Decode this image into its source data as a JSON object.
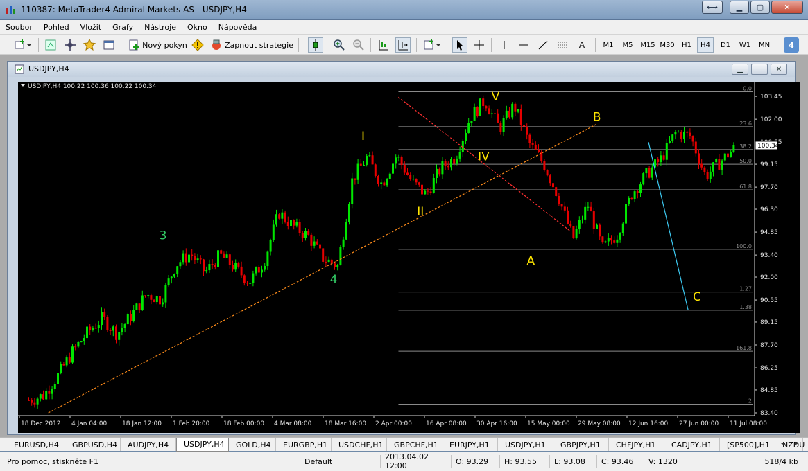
{
  "window": {
    "title": "110387: MetaTrader4 Admiral Markets AS - USDJPY,H4"
  },
  "menu": [
    "Soubor",
    "Pohled",
    "Vložit",
    "Grafy",
    "Nástroje",
    "Okno",
    "Nápověda"
  ],
  "toolbar": {
    "new_order": "Nový pokyn",
    "strategies": "Zapnout strategie",
    "timeframes": [
      "M1",
      "M5",
      "M15",
      "M30",
      "H1",
      "H4",
      "D1",
      "W1",
      "MN"
    ],
    "active_timeframe": "H4",
    "text_tool": "A",
    "badge": "4"
  },
  "chart_window": {
    "title": "USDJPY,H4",
    "info": "USDJPY,H4  100.22 100.36 100.22 100.34",
    "current_price": "100.34"
  },
  "chart_data": {
    "type": "candlestick",
    "symbol": "USDJPY",
    "timeframe": "H4",
    "ylim": [
      83.4,
      104.2
    ],
    "price_ticks": [
      103.45,
      102.0,
      100.55,
      99.15,
      97.7,
      96.3,
      94.85,
      93.4,
      92.0,
      90.55,
      89.15,
      87.7,
      86.25,
      84.85,
      83.4
    ],
    "price_tick_labels": [
      "103.45",
      "102.00",
      "100.55",
      "99.15",
      "97.70",
      "96.30",
      "94.85",
      "93.40",
      "92.00",
      "90.55",
      "89.15",
      "87.70",
      "86.25",
      "84.85",
      "83.40"
    ],
    "time_labels": [
      "18 Dec 2012",
      "4 Jan 04:00",
      "18 Jan 12:00",
      "1 Feb 20:00",
      "18 Feb 00:00",
      "4 Mar 08:00",
      "18 Mar 16:00",
      "2 Apr 00:00",
      "16 Apr 08:00",
      "30 Apr 16:00",
      "15 May 00:00",
      "29 May 08:00",
      "12 Jun 16:00",
      "27 Jun 00:00",
      "11 Jul 08:00"
    ],
    "price_path": [
      [
        0,
        84.2
      ],
      [
        1,
        84.5
      ],
      [
        2,
        85.8
      ],
      [
        3,
        87.3
      ],
      [
        4,
        88.5
      ],
      [
        5,
        89.4
      ],
      [
        6,
        88.4
      ],
      [
        7,
        89.6
      ],
      [
        8,
        90.9
      ],
      [
        9,
        90.6
      ],
      [
        10,
        92.8
      ],
      [
        11,
        93.5
      ],
      [
        12,
        92.3
      ],
      [
        13,
        93.4
      ],
      [
        14,
        92.6
      ],
      [
        15,
        91.7
      ],
      [
        16,
        93.0
      ],
      [
        17,
        96.1
      ],
      [
        18,
        95.2
      ],
      [
        19,
        94.6
      ],
      [
        20,
        93.2
      ],
      [
        21,
        92.7
      ],
      [
        22,
        98.2
      ],
      [
        23,
        99.6
      ],
      [
        24,
        97.9
      ],
      [
        25,
        99.7
      ],
      [
        26,
        98.1
      ],
      [
        27,
        97.2
      ],
      [
        28,
        98.9
      ],
      [
        29,
        99.6
      ],
      [
        30,
        102.1
      ],
      [
        31,
        103.2
      ],
      [
        32,
        101.4
      ],
      [
        33,
        102.9
      ],
      [
        34,
        100.5
      ],
      [
        35,
        99.2
      ],
      [
        36,
        97.1
      ],
      [
        37,
        94.4
      ],
      [
        38,
        96.6
      ],
      [
        39,
        93.8
      ],
      [
        40,
        94.7
      ],
      [
        41,
        97.3
      ],
      [
        42,
        98.5
      ],
      [
        43,
        99.5
      ],
      [
        44,
        101.2
      ],
      [
        45,
        100.9
      ],
      [
        46,
        98.4
      ],
      [
        47,
        99.3
      ],
      [
        48,
        100.2
      ]
    ],
    "x_count": 49,
    "fib_levels": [
      {
        "label": "0.0",
        "value": 103.74
      },
      {
        "label": "23.6",
        "value": 101.53
      },
      {
        "label": "38.2",
        "value": 100.08
      },
      {
        "label": "50.0",
        "value": 99.15
      },
      {
        "label": "61.8",
        "value": 97.53
      },
      {
        "label": "100.0",
        "value": 93.76
      },
      {
        "label": "1.27",
        "value": 91.05
      },
      {
        "label": "1.38",
        "value": 89.9
      },
      {
        "label": "161.8",
        "value": 87.3
      },
      {
        "label": "2",
        "value": 83.95
      }
    ],
    "wave_labels": [
      {
        "text": "3",
        "x": 9.2,
        "y": 94.4,
        "color": "#33cc66"
      },
      {
        "text": "4",
        "x": 20.8,
        "y": 91.6,
        "color": "#33cc66"
      },
      {
        "text": "I",
        "x": 22.8,
        "y": 100.7,
        "color": "#ffe600"
      },
      {
        "text": "II",
        "x": 26.7,
        "y": 95.9,
        "color": "#ffe600"
      },
      {
        "text": "V",
        "x": 31.8,
        "y": 103.2,
        "color": "#ffe600"
      },
      {
        "text": "IV",
        "x": 31.0,
        "y": 99.4,
        "color": "#ffe600"
      },
      {
        "text": "A",
        "x": 34.2,
        "y": 92.8,
        "color": "#ffe600"
      },
      {
        "text": "B",
        "x": 38.7,
        "y": 101.9,
        "color": "#ffe600"
      },
      {
        "text": "C",
        "x": 45.5,
        "y": 90.5,
        "color": "#ffe600"
      }
    ],
    "trendlines": [
      {
        "from": [
          1.4,
          83.4
        ],
        "to": [
          38.7,
          101.7
        ],
        "color": "#ff8c1a",
        "dash": true
      },
      {
        "from": [
          25.2,
          103.4
        ],
        "to": [
          36.9,
          94.9
        ],
        "color": "#ff3030",
        "dash": true
      },
      {
        "from": [
          42.2,
          100.55
        ],
        "to": [
          44.9,
          89.9
        ],
        "color": "#3cc8f0",
        "dash": false
      }
    ]
  },
  "tabs": {
    "items": [
      "EURUSD,H4",
      "GBPUSD,H4",
      "AUDJPY,H4",
      "USDJPY,H4",
      "GOLD,H4",
      "EURGBP,H1",
      "USDCHF,H1",
      "GBPCHF,H1",
      "EURJPY,H1",
      "USDJPY,H1",
      "GBPJPY,H1",
      "CHFJPY,H1",
      "CADJPY,H1",
      "[SP500],H1",
      "NZDU"
    ],
    "active": "USDJPY,H4"
  },
  "statusbar": {
    "help": "Pro pomoc, stiskněte F1",
    "profile": "Default",
    "datetime": "2013.04.02 12:00",
    "open": "O: 93.29",
    "high": "H: 93.55",
    "low": "L: 93.08",
    "close": "C: 93.46",
    "volume": "V: 1320",
    "traffic": "518/4 kb"
  }
}
